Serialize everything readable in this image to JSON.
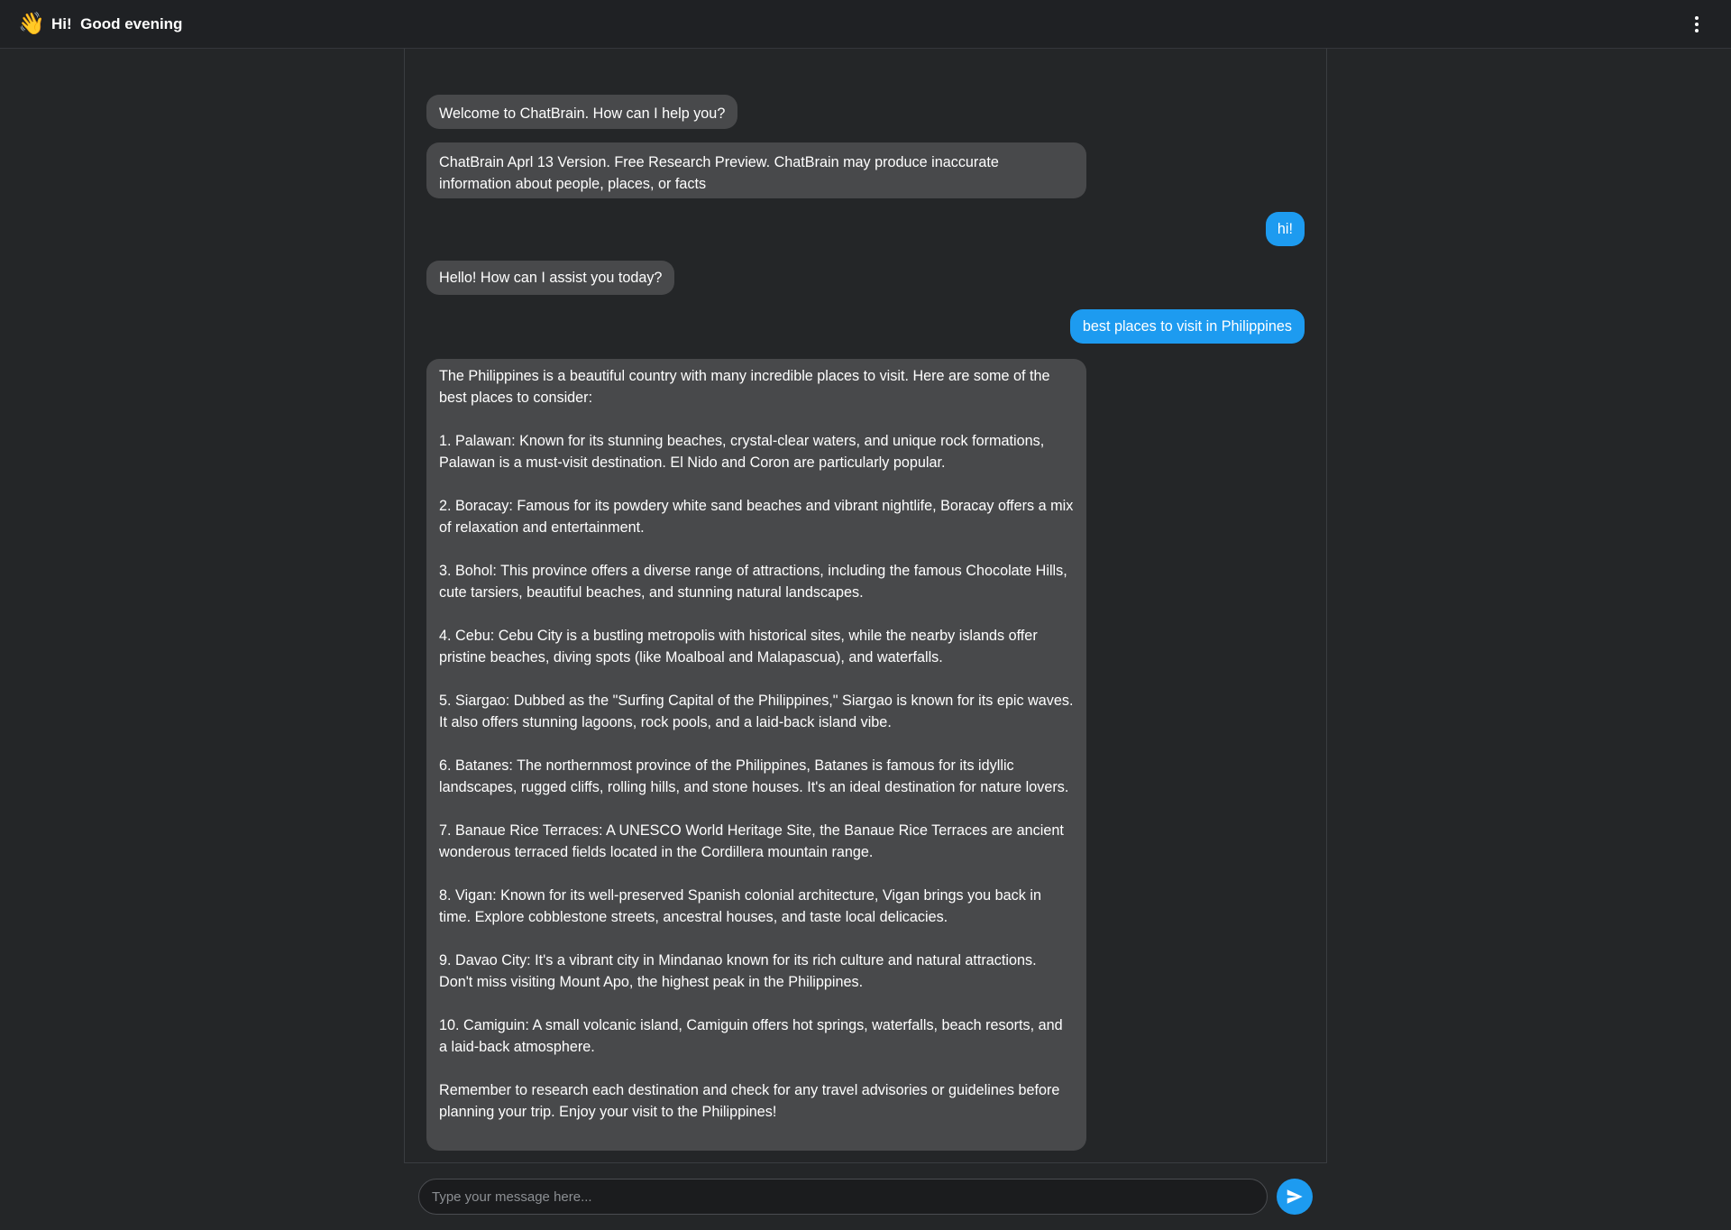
{
  "header": {
    "greeting": "Hi!  Good evening",
    "wave_icon": "waving-hand-icon",
    "menu_icon": "vertical-dots-icon"
  },
  "messages": [
    {
      "role": "bot",
      "text": "Welcome to ChatBrain. How can I help you?"
    },
    {
      "role": "bot",
      "text": "ChatBrain Aprl 13 Version. Free Research Preview. ChatBrain may produce inaccurate information about people, places, or facts"
    },
    {
      "role": "user",
      "text": "hi!"
    },
    {
      "role": "bot",
      "text": "Hello! How can I assist you today?"
    },
    {
      "role": "user",
      "text": "best places to visit in Philippines"
    },
    {
      "role": "bot",
      "text": "The Philippines is a beautiful country with many incredible places to visit. Here are some of the best places to consider:\n\n1. Palawan: Known for its stunning beaches, crystal-clear waters, and unique rock formations, Palawan is a must-visit destination. El Nido and Coron are particularly popular.\n\n2. Boracay: Famous for its powdery white sand beaches and vibrant nightlife, Boracay offers a mix of relaxation and entertainment.\n\n3. Bohol: This province offers a diverse range of attractions, including the famous Chocolate Hills, cute tarsiers, beautiful beaches, and stunning natural landscapes.\n\n4. Cebu: Cebu City is a bustling metropolis with historical sites, while the nearby islands offer pristine beaches, diving spots (like Moalboal and Malapascua), and waterfalls.\n\n5. Siargao: Dubbed as the \"Surfing Capital of the Philippines,\" Siargao is known for its epic waves. It also offers stunning lagoons, rock pools, and a laid-back island vibe.\n\n6. Batanes: The northernmost province of the Philippines, Batanes is famous for its idyllic landscapes, rugged cliffs, rolling hills, and stone houses. It's an ideal destination for nature lovers.\n\n7. Banaue Rice Terraces: A UNESCO World Heritage Site, the Banaue Rice Terraces are ancient wonderous terraced fields located in the Cordillera mountain range.\n\n8. Vigan: Known for its well-preserved Spanish colonial architecture, Vigan brings you back in time. Explore cobblestone streets, ancestral houses, and taste local delicacies.\n\n9. Davao City: It's a vibrant city in Mindanao known for its rich culture and natural attractions. Don't miss visiting Mount Apo, the highest peak in the Philippines.\n\n10. Camiguin: A small volcanic island, Camiguin offers hot springs, waterfalls, beach resorts, and a laid-back atmosphere.\n\nRemember to research each destination and check for any travel advisories or guidelines before planning your trip. Enjoy your visit to the Philippines!"
    }
  ],
  "composer": {
    "placeholder": "Type your message here...",
    "value": "",
    "send_icon": "send-icon"
  },
  "colors": {
    "background": "#242628",
    "bot_bubble": "#48494b",
    "user_bubble": "#1d9bf0"
  }
}
